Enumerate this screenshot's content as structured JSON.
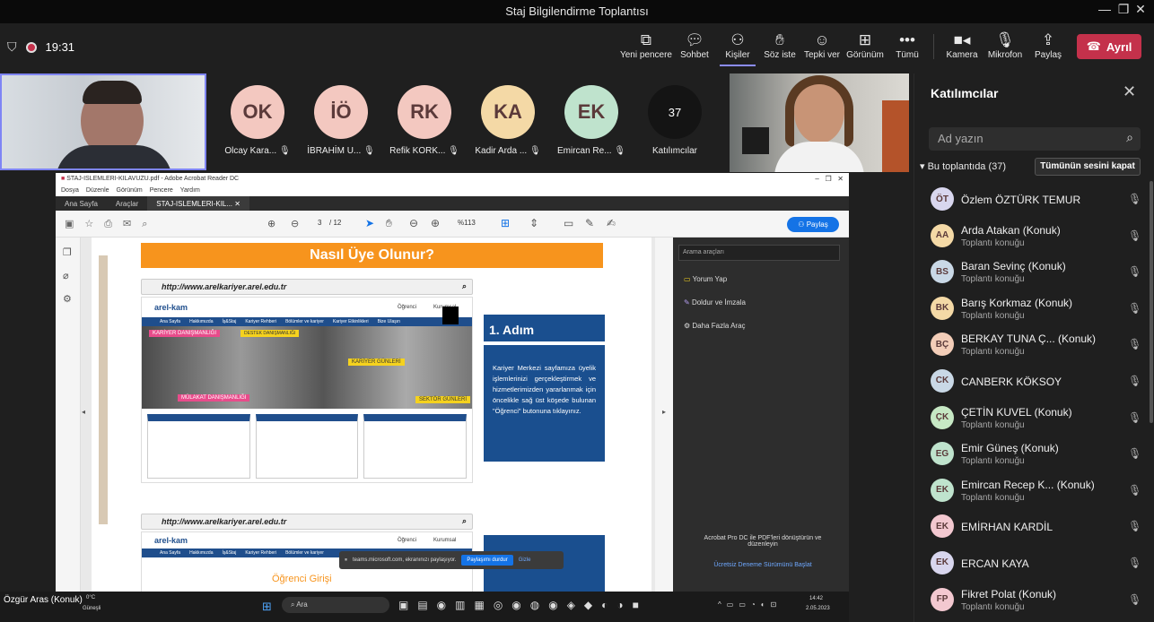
{
  "window": {
    "title": "Staj Bilgilendirme Toplantısı"
  },
  "toolbar": {
    "time": "19:31",
    "buttons": [
      {
        "label": "Yeni pencere",
        "icon": "popout-icon"
      },
      {
        "label": "Sohbet",
        "icon": "chat-icon"
      },
      {
        "label": "Kişiler",
        "icon": "people-icon"
      },
      {
        "label": "Söz iste",
        "icon": "raise-hand-icon"
      },
      {
        "label": "Tepki ver",
        "icon": "emoji-icon"
      },
      {
        "label": "Görünüm",
        "icon": "grid-icon"
      },
      {
        "label": "Tümü",
        "icon": "more-icon"
      },
      {
        "label": "Kamera",
        "icon": "camera-icon"
      },
      {
        "label": "Mikrofon",
        "icon": "mic-off-icon"
      },
      {
        "label": "Paylaş",
        "icon": "share-icon"
      }
    ],
    "leave_label": "Ayrıl"
  },
  "tiles": [
    {
      "initials": "OK",
      "name": "Olcay Kara...",
      "color": "#f3c8c0"
    },
    {
      "initials": "İÖ",
      "name": "İBRAHİM U...",
      "color": "#f3c8c0"
    },
    {
      "initials": "RK",
      "name": "Refik KORK...",
      "color": "#f3c8c0"
    },
    {
      "initials": "KA",
      "name": "Kadir Arda ...",
      "color": "#f4d9a6"
    },
    {
      "initials": "EK",
      "name": "Emircan Re...",
      "color": "#bfe3cd"
    }
  ],
  "overflow": {
    "count": "37",
    "label": "Katılımcılar"
  },
  "share": {
    "acrobat_title": "STAJ-ISLEMLERI-KILAVUZU.pdf - Adobe Acrobat Reader DC",
    "menu": [
      "Dosya",
      "Düzenle",
      "Görünüm",
      "Pencere",
      "Yardım"
    ],
    "tabs": [
      "Ana Sayfa",
      "Araçlar",
      "STAJ-ISLEMLERI-KIL..."
    ],
    "page_current": "3",
    "page_total": "/ 12",
    "zoom": "%113",
    "share_btn": "Paylaş",
    "heading": "Nasıl Üye Olunur?",
    "url": "http://www.arelkariyer.arel.edu.tr",
    "step_title": "1. Adım",
    "step_text": "Kariyer Merkezi sayfamıza üyelik işlemlerinizi gerçekleştirmek ve hizmetlerimizden yararlanmak için öncelikle sağ üst köşede bulunan \"Öğrenci\" butonuna tıklayınız.",
    "nav_items": [
      "Ana Sayfa",
      "Hakkımızda",
      "İş&Staj",
      "Kariyer Rehberi",
      "Bölümler ve kariyer",
      "Kariyer Etkinlikleri",
      "Bize Ulaşın"
    ],
    "logo_text": "arel-kam",
    "top_links": [
      "Öğrenci",
      "Kurumsal"
    ],
    "banner_labels": [
      "KARİYER DANIŞMANLIĞI",
      "DESTEK DANIŞMANLIĞI",
      "KARİYER GÜNLERİ",
      "MÜLAKAT DANIŞMANLIĞI",
      "SEKTÖR GÜNLERİ"
    ],
    "student_login": "Öğrenci Girişi",
    "right_pane": {
      "search": "Arama araçları",
      "tools": [
        "Yorum Yap",
        "Doldur ve İmzala",
        "Daha Fazla Araç"
      ],
      "promo": "Acrobat Pro DC ile PDF'leri dönüştürün ve düzenleyin",
      "promo_link": "Ücretsiz Deneme Sürümünü Başlat"
    },
    "share_popup": {
      "text": "teams.microsoft.com, ekranınızı paylaşıyor.",
      "stop": "Paylaşımı durdur",
      "hide": "Gizle"
    },
    "taskbar": {
      "weather_temp": "0°C",
      "weather_label": "Güneşli",
      "search": "Ara",
      "clock": "14:42",
      "date": "2.05.2023"
    },
    "presenter": "Özgür Aras (Konuk)"
  },
  "panel": {
    "title": "Katılımcılar",
    "search_placeholder": "Ad yazın",
    "section": "Bu toplantıda (37)",
    "mute_all": "Tümünün sesini kapat",
    "participants": [
      {
        "initials": "ÖT",
        "name": "Özlem ÖZTÜRK TEMUR",
        "sub": "",
        "color": "#d8d6ee"
      },
      {
        "initials": "AA",
        "name": "Arda Atakan (Konuk)",
        "sub": "Toplantı konuğu",
        "color": "#f4d9a6"
      },
      {
        "initials": "BS",
        "name": "Baran Sevinç (Konuk)",
        "sub": "Toplantı konuğu",
        "color": "#c9d8e6"
      },
      {
        "initials": "BK",
        "name": "Barış Korkmaz (Konuk)",
        "sub": "Toplantı konuğu",
        "color": "#f4d9a6"
      },
      {
        "initials": "BÇ",
        "name": "BERKAY TUNA Ç... (Konuk)",
        "sub": "Toplantı konuğu",
        "color": "#f3cdb8"
      },
      {
        "initials": "CK",
        "name": "CANBERK KÖKSOY",
        "sub": "",
        "color": "#c9d8e6"
      },
      {
        "initials": "ÇK",
        "name": "ÇETİN KUVEL (Konuk)",
        "sub": "Toplantı konuğu",
        "color": "#c6e8c4"
      },
      {
        "initials": "EG",
        "name": "Emir Güneş (Konuk)",
        "sub": "Toplantı konuğu",
        "color": "#bfe3cd"
      },
      {
        "initials": "EK",
        "name": "Emircan Recep K... (Konuk)",
        "sub": "Toplantı konuğu",
        "color": "#bfe3cd"
      },
      {
        "initials": "EK",
        "name": "EMİRHAN KARDİL",
        "sub": "",
        "color": "#f3c8d0"
      },
      {
        "initials": "EK",
        "name": "ERCAN KAYA",
        "sub": "",
        "color": "#d8d6ee"
      },
      {
        "initials": "FP",
        "name": "Fikret Polat (Konuk)",
        "sub": "Toplantı konuğu",
        "color": "#f3c8d0"
      }
    ]
  },
  "colors": {
    "accent": "#7f85f5",
    "leave": "#c4314b",
    "orange": "#f7941d",
    "blue": "#1a4f8f"
  }
}
